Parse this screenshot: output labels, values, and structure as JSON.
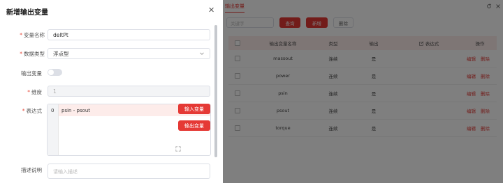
{
  "dialog": {
    "title": "新增输出变量",
    "fields": {
      "name": {
        "label": "变量名称",
        "value": "deltPt"
      },
      "type": {
        "label": "数据类型",
        "value": "浮点型"
      },
      "output": {
        "label": "输出变量"
      },
      "dimension": {
        "label": "维度",
        "value": "1"
      },
      "expression": {
        "label": "表达式",
        "line_no": "0",
        "code": "psin - psout"
      },
      "description": {
        "label": "描述说明",
        "placeholder": "请输入描述"
      }
    },
    "buttons": {
      "input_var": "输入变量",
      "output_var": "输出变量"
    }
  },
  "page": {
    "tab": "输出变量",
    "search_placeholder": "关键字",
    "toolbar": {
      "query": "查询",
      "add": "新增",
      "delete": "删除"
    },
    "columns": {
      "name": "输出变量名称",
      "type": "类型",
      "output": "输出",
      "expression": "表达式",
      "action": "操作"
    },
    "rows": [
      {
        "name": "massout",
        "type": "连续",
        "output": "是"
      },
      {
        "name": "power",
        "type": "连续",
        "output": "是"
      },
      {
        "name": "psin",
        "type": "连续",
        "output": "是"
      },
      {
        "name": "psout",
        "type": "连续",
        "output": "是"
      },
      {
        "name": "torque",
        "type": "连续",
        "output": "是"
      }
    ],
    "row_actions": {
      "edit": "编辑",
      "delete": "删除"
    }
  },
  "colors": {
    "accent": "#e53935",
    "header_bg": "#fdecea"
  }
}
